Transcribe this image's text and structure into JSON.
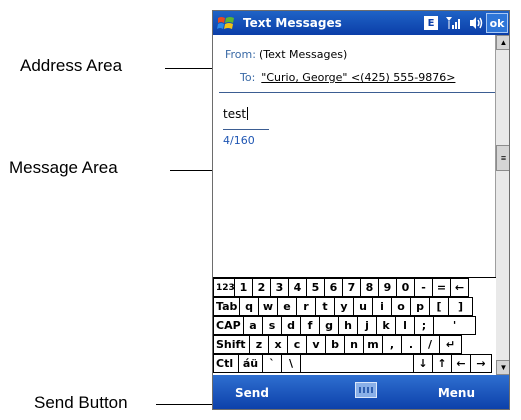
{
  "callouts": {
    "address_area": "Address Area",
    "message_area": "Message Area",
    "send_button": "Send Button"
  },
  "titlebar": {
    "title": "Text Messages",
    "e_icon": "E",
    "signal_icon": "signal-icon",
    "volume_icon": "speaker-icon",
    "ok_label": "ok"
  },
  "address": {
    "from_label": "From:",
    "from_value": "(Text Messages)",
    "to_label": "To:",
    "to_value": "\"Curio, George\" <(425) 555-9876>"
  },
  "message": {
    "text": "test",
    "counter": "4/160"
  },
  "keyboard": {
    "rows": [
      [
        "123",
        "1",
        "2",
        "3",
        "4",
        "5",
        "6",
        "7",
        "8",
        "9",
        "0",
        "-",
        "=",
        "←"
      ],
      [
        "Tab",
        "q",
        "w",
        "e",
        "r",
        "t",
        "y",
        "u",
        "i",
        "o",
        "p",
        "[",
        "]"
      ],
      [
        "CAP",
        "a",
        "s",
        "d",
        "f",
        "g",
        "h",
        "j",
        "k",
        "l",
        ";",
        "'"
      ],
      [
        "Shift",
        "z",
        "x",
        "c",
        "v",
        "b",
        "n",
        "m",
        ",",
        ".",
        "/",
        "↵"
      ],
      [
        "Ctl",
        "áü",
        "`",
        "\\",
        "",
        "↓",
        "↑",
        "←",
        "→"
      ]
    ]
  },
  "menubar": {
    "send_label": "Send",
    "menu_label": "Menu",
    "keyboard_icon": "keyboard-icon"
  },
  "colors": {
    "titlebar": "#0b3ea8",
    "menubar": "#0b3ea8",
    "label_blue": "#3a6aa6",
    "counter_blue": "#1f56b3"
  }
}
